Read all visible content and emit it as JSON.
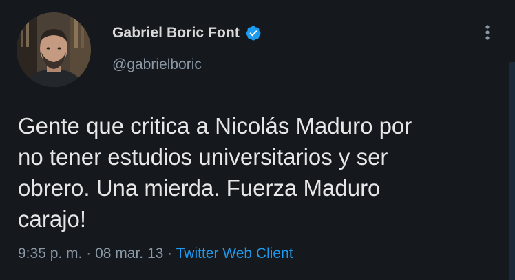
{
  "tweet": {
    "display_name": "Gabriel Boric Font",
    "handle": "@gabrielboric",
    "text": "Gente que critica a Nicolás Maduro por\nno tener estudios universitarios y ser\nobrero. Una mierda. Fuerza Maduro\ncarajo!",
    "time": "9:35 p. m.",
    "separator": "·",
    "date": "08 mar. 13",
    "client": "Twitter Web Client"
  },
  "icons": {
    "verified": "verified-badge-icon",
    "more": "more-vertical-icon"
  },
  "colors": {
    "background": "#15181c",
    "verified_blue": "#1d9bf0",
    "link_blue": "#1d9bf0",
    "secondary_text": "#8b98a5"
  }
}
